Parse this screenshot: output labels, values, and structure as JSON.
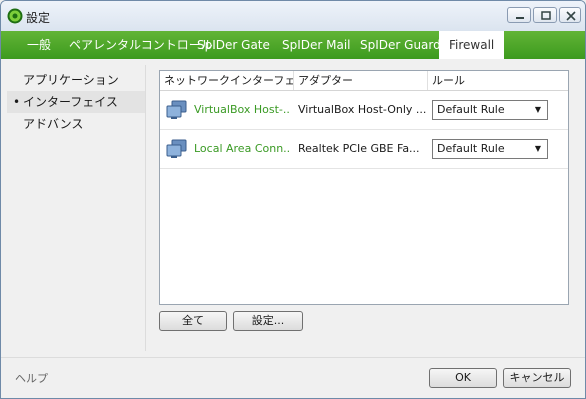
{
  "window": {
    "title": "設定"
  },
  "tabs": [
    {
      "label": "一般"
    },
    {
      "label": "ペアレンタルコントロール"
    },
    {
      "label": "SpIDer Gate"
    },
    {
      "label": "SpIDer Mail"
    },
    {
      "label": "SpIDer Guard"
    },
    {
      "label": "Firewall"
    }
  ],
  "sidebar": {
    "items": [
      {
        "label": "アプリケーション"
      },
      {
        "label": "インターフェイス",
        "bullet": "•"
      },
      {
        "label": "アドバンス"
      }
    ]
  },
  "table": {
    "headers": [
      "ネットワークインターフェ...",
      "アダプター",
      "ルール"
    ],
    "rows": [
      {
        "interface": "VirtualBox Host-...",
        "adapter": "VirtualBox Host-Only ...",
        "rule": "Default Rule"
      },
      {
        "interface": "Local Area Conn...",
        "adapter": "Realtek PCIe GBE Fa...",
        "rule": "Default Rule"
      }
    ]
  },
  "actions": {
    "all_label": "全て",
    "settings_label": "設定..."
  },
  "footer": {
    "help_label": "ヘルプ",
    "ok_label": "OK",
    "cancel_label": "キャンセル"
  },
  "colors": {
    "tab_bar": "#4aa52a",
    "interface_text": "#3a9a24"
  },
  "icons": {
    "app": "shield-icon",
    "interface": "network-monitor-icon"
  }
}
